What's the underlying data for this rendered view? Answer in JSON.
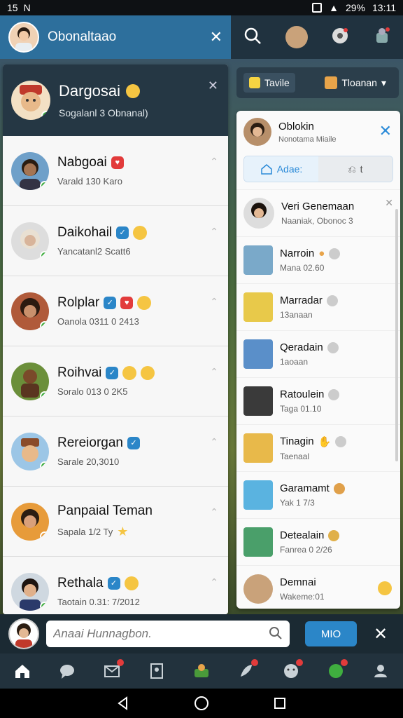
{
  "status_bar": {
    "left_a": "15",
    "left_b": "N",
    "battery": "29%",
    "time": "13:11"
  },
  "top_bar": {
    "title": "Obonaltaao"
  },
  "left_panel": {
    "header": {
      "title": "Dargosai",
      "subtitle": "Sogalanl 3 Obnanal)"
    },
    "items": [
      {
        "name": "Nabgoai",
        "meta": "Varald 130 Karo"
      },
      {
        "name": "Daikohail",
        "meta": "Yancatanl2 Scatt6"
      },
      {
        "name": "Rolplar",
        "meta": "Oanola 0311 0 2413"
      },
      {
        "name": "Roihvai",
        "meta": "Soralo 013 0 2K5"
      },
      {
        "name": "Rereiorgan",
        "meta": "Sarale 20,3010"
      },
      {
        "name": "Panpaial Teman",
        "meta": "Sapala 1/2 Ty"
      },
      {
        "name": "Rethala",
        "meta": "Taotain 0.31: 7/2012"
      }
    ]
  },
  "right_tabs": {
    "tab1": "Tavile",
    "tab2": "Tloanan"
  },
  "right_panel": {
    "header": {
      "name": "Oblokin",
      "sub": "Nonotama Miaile"
    },
    "seg_label": "Adae:",
    "seg_other": "t",
    "items": [
      {
        "name": "Veri Genemaan",
        "meta": "Naaniak, Obonoc 3"
      },
      {
        "name": "Narroin",
        "meta": "Mana 02.60"
      },
      {
        "name": "Marradar",
        "meta": "13anaan"
      },
      {
        "name": "Qeradain",
        "meta": "1aoaan"
      },
      {
        "name": "Ratoulein",
        "meta": "Taga 01.10"
      },
      {
        "name": "Tinagin",
        "meta": "Taenaal"
      },
      {
        "name": "Garamamt",
        "meta": "Yak 1 7/3"
      },
      {
        "name": "Detealain",
        "meta": "Fanrea 0 2/26"
      },
      {
        "name": "Demnai",
        "meta": "Wakeme:01"
      }
    ]
  },
  "search": {
    "placeholder": "Anaai Hunnagbon.",
    "button_label": "MIO"
  },
  "colors": {
    "accent": "#2b86c8",
    "header": "#253744",
    "online": "#3fae3f"
  }
}
